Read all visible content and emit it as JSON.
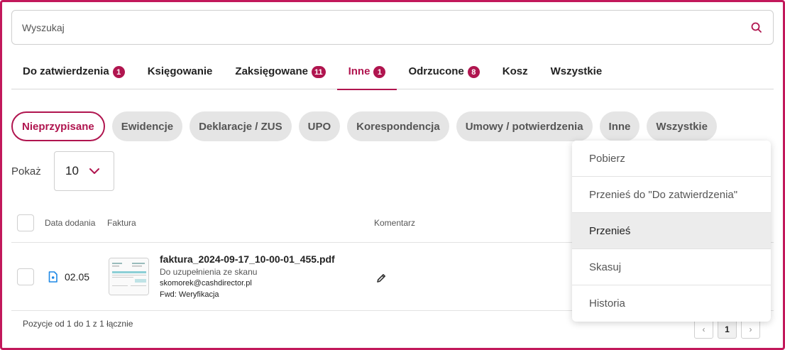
{
  "search": {
    "placeholder": "Wyszukaj"
  },
  "tabs": [
    {
      "label": "Do zatwierdzenia",
      "badge": "1"
    },
    {
      "label": "Księgowanie",
      "badge": ""
    },
    {
      "label": "Zaksięgowane",
      "badge": "11"
    },
    {
      "label": "Inne",
      "badge": "1",
      "active": true
    },
    {
      "label": "Odrzucone",
      "badge": "8"
    },
    {
      "label": "Kosz",
      "badge": ""
    },
    {
      "label": "Wszystkie",
      "badge": ""
    }
  ],
  "chips": [
    {
      "label": "Nieprzypisane",
      "active": true
    },
    {
      "label": "Ewidencje"
    },
    {
      "label": "Deklaracje / ZUS"
    },
    {
      "label": "UPO"
    },
    {
      "label": "Korespondencja"
    },
    {
      "label": "Umowy / potwierdzenia"
    },
    {
      "label": "Inne"
    },
    {
      "label": "Wszystkie"
    }
  ],
  "page_size": {
    "label": "Pokaż",
    "value": "10"
  },
  "table": {
    "headers": {
      "date": "Data dodania",
      "invoice": "Faktura",
      "comment": "Komentarz"
    },
    "rows": [
      {
        "date": "02.05",
        "filename": "faktura_2024-09-17_10-00-01_455.pdf",
        "note": "Do uzupełnienia ze skanu",
        "email": "skomorek@cashdirector.pl",
        "fwd": "Fwd: Weryfikacja"
      }
    ]
  },
  "footer": {
    "summary": "Pozycje od 1 do 1 z 1 łącznie"
  },
  "pager": {
    "prev": "‹",
    "current": "1",
    "next": "›"
  },
  "context_menu": {
    "items": [
      {
        "label": "Pobierz"
      },
      {
        "label": "Przenieś do \"Do zatwierdzenia\""
      },
      {
        "label": "Przenieś",
        "hover": true
      },
      {
        "label": "Skasuj"
      },
      {
        "label": "Historia"
      }
    ]
  },
  "colors": {
    "accent": "#b0154f",
    "chip_bg": "#e5e5e5",
    "file_icon": "#1e88e5"
  }
}
